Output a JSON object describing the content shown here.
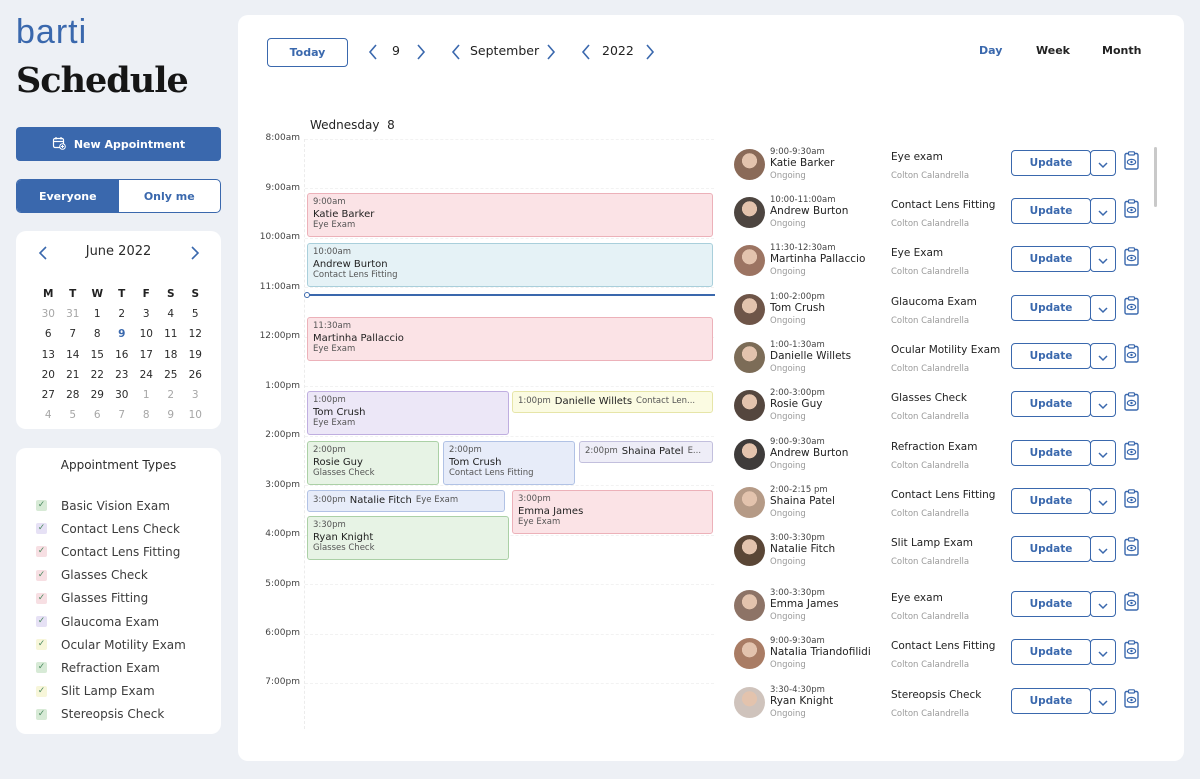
{
  "app": {
    "logo": "barti",
    "title": "Schedule"
  },
  "sidebar": {
    "new_appointment": "New Appointment",
    "filter": {
      "everyone": "Everyone",
      "only_me": "Only me",
      "selected": "Everyone"
    },
    "mini_calendar": {
      "month_label": "June 2022",
      "weekdays": [
        "M",
        "T",
        "W",
        "T",
        "F",
        "S",
        "S"
      ],
      "weeks": [
        [
          "30",
          "31",
          "1",
          "2",
          "3",
          "4",
          "5"
        ],
        [
          "6",
          "7",
          "8",
          "9",
          "10",
          "11",
          "12"
        ],
        [
          "13",
          "14",
          "15",
          "16",
          "17",
          "18",
          "19"
        ],
        [
          "20",
          "21",
          "22",
          "23",
          "24",
          "25",
          "26"
        ],
        [
          "27",
          "28",
          "29",
          "30",
          "1",
          "2",
          "3"
        ],
        [
          "4",
          "5",
          "6",
          "7",
          "8",
          "9",
          "10"
        ]
      ],
      "selected_day": "9"
    },
    "appointment_types": {
      "title": "Appointment Types",
      "items": [
        {
          "label": "Basic Vision Exam",
          "color": "#d7ead6"
        },
        {
          "label": "Contact Lens Check",
          "color": "#e6e1f5"
        },
        {
          "label": "Contact Lens Fitting",
          "color": "#f7dfe3"
        },
        {
          "label": "Glasses Check",
          "color": "#f7dfe3"
        },
        {
          "label": "Glasses Fitting",
          "color": "#f7dfe3"
        },
        {
          "label": "Glaucoma Exam",
          "color": "#e6e1f5"
        },
        {
          "label": "Ocular Motility Exam",
          "color": "#f7f6d9"
        },
        {
          "label": "Refraction Exam",
          "color": "#d7ead6"
        },
        {
          "label": "Slit Lamp Exam",
          "color": "#f7f6d9"
        },
        {
          "label": "Stereopsis Check",
          "color": "#d7ead6"
        }
      ]
    }
  },
  "toolbar": {
    "today": "Today",
    "day": "9",
    "month": "September",
    "year": "2022",
    "views": [
      "Day",
      "Week",
      "Month"
    ],
    "active_view": "Day"
  },
  "day_view": {
    "header_day": "Wednesday",
    "header_date": "8",
    "times": [
      "8:00am",
      "9:00am",
      "10:00am",
      "11:00am",
      "12:00pm",
      "1:00pm",
      "2:00pm",
      "3:00pm",
      "4:00pm",
      "5:00pm",
      "6:00pm",
      "7:00pm"
    ],
    "events": [
      {
        "time": "9:00am",
        "name": "Katie Barker",
        "type": "Eye Exam"
      },
      {
        "time": "10:00am",
        "name": "Andrew Burton",
        "type": "Contact Lens Fitting"
      },
      {
        "time": "11:30am",
        "name": "Martinha Pallaccio",
        "type": "Eye Exam"
      },
      {
        "time": "1:00pm",
        "name": "Tom Crush",
        "type": "Eye Exam"
      },
      {
        "time": "1:00pm",
        "name": "Danielle Willets",
        "type": "Contact Len..."
      },
      {
        "time": "2:00pm",
        "name": "Rosie Guy",
        "type": "Glasses Check"
      },
      {
        "time": "2:00pm",
        "name": "Tom Crush",
        "type": "Contact Lens Fitting"
      },
      {
        "time": "2:00pm",
        "name": "Shaina Patel",
        "type": "E..."
      },
      {
        "time": "3:00pm",
        "name": "Natalie Fitch",
        "type": "Eye Exam"
      },
      {
        "time": "3:00pm",
        "name": "Emma James",
        "type": "Eye Exam"
      },
      {
        "time": "3:30pm",
        "name": "Ryan Knight",
        "type": "Glasses Check"
      }
    ]
  },
  "appointments": {
    "update_label": "Update",
    "items": [
      {
        "time": "9:00-9:30am",
        "name": "Katie Barker",
        "status": "Ongoing",
        "type": "Eye exam",
        "doctor": "Colton Calandrella"
      },
      {
        "time": "10:00-11:00am",
        "name": "Andrew Burton",
        "status": "Ongoing",
        "type": "Contact Lens Fitting",
        "doctor": "Colton Calandrella"
      },
      {
        "time": "11:30-12:30am",
        "name": "Martinha Pallaccio",
        "status": "Ongoing",
        "type": "Eye Exam",
        "doctor": "Colton Calandrella"
      },
      {
        "time": "1:00-2:00pm",
        "name": "Tom Crush",
        "status": "Ongoing",
        "type": "Glaucoma Exam",
        "doctor": "Colton Calandrella"
      },
      {
        "time": "1:00-1:30am",
        "name": "Danielle Willets",
        "status": "Ongoing",
        "type": "Ocular Motility Exam",
        "doctor": "Colton Calandrella"
      },
      {
        "time": "2:00-3:00pm",
        "name": "Rosie Guy",
        "status": "Ongoing",
        "type": "Glasses Check",
        "doctor": "Colton Calandrella"
      },
      {
        "time": "9:00-9:30am",
        "name": "Andrew Burton",
        "status": "Ongoing",
        "type": "Refraction Exam",
        "doctor": "Colton Calandrella"
      },
      {
        "time": "2:00-2:15 pm",
        "name": "Shaina Patel",
        "status": "Ongoing",
        "type": "Contact Lens Fitting",
        "doctor": "Colton Calandrella"
      },
      {
        "time": "3:00-3:30pm",
        "name": "Natalie Fitch",
        "status": "Ongoing",
        "type": "Slit Lamp Exam",
        "doctor": "Colton Calandrella"
      },
      {
        "time": "3:00-3:30pm",
        "name": "Emma James",
        "status": "Ongoing",
        "type": "Eye exam",
        "doctor": "Colton Calandrella"
      },
      {
        "time": "9:00-9:30am",
        "name": "Natalia Triandofilidi",
        "status": "Ongoing",
        "type": "Contact Lens Fitting",
        "doctor": "Colton Calandrella"
      },
      {
        "time": "3:30-4:30pm",
        "name": "Ryan Knight",
        "status": "Ongoing",
        "type": "Stereopsis Check",
        "doctor": "Colton Calandrella"
      }
    ]
  }
}
